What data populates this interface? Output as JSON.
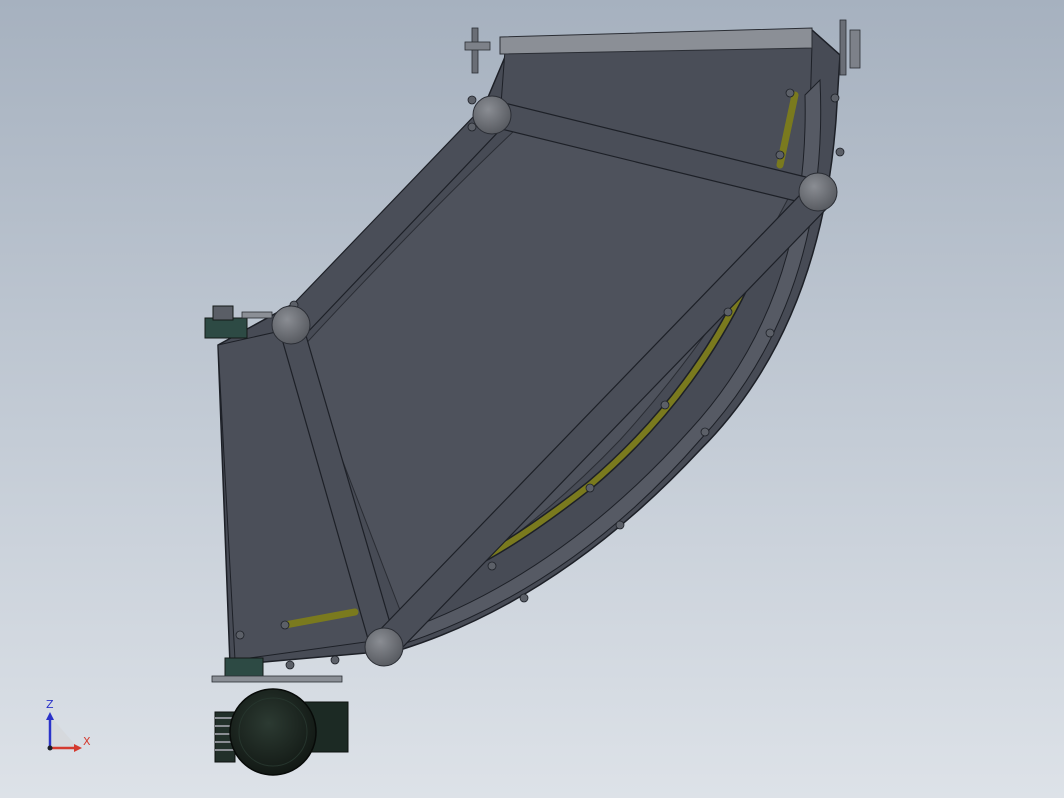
{
  "scene": {
    "description_type": "cad-viewport",
    "background_top": "#a6b1bf",
    "background_bottom": "#dde2e8",
    "body_color": "#474b55",
    "edge_color": "#1d2027",
    "rail_color": "#7a7a1e",
    "roller_color": "#6a6d73"
  },
  "triad": {
    "z_label": "Z",
    "x_label": "X",
    "z_color": "#2b33c9",
    "x_color": "#d43a2f"
  }
}
